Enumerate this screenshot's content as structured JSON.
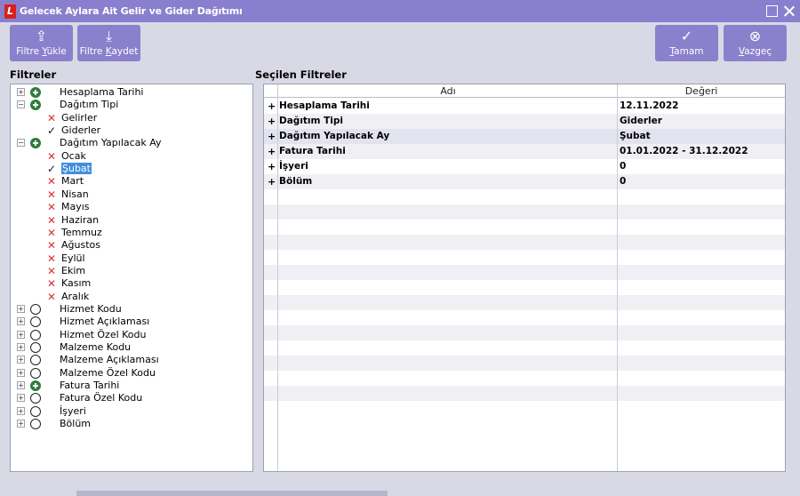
{
  "window": {
    "title": "Gelecek Aylara Ait Gelir ve Gider Dağıtımı",
    "logo_letter": "L"
  },
  "toolbar": {
    "load_filter": {
      "pre": "Filtre ",
      "ul": "Y",
      "post": "ükle",
      "icon": "⇪"
    },
    "save_filter": {
      "pre": "Filtre ",
      "ul": "K",
      "post": "aydet",
      "icon": "⤓"
    },
    "ok": {
      "pre": "",
      "ul": "T",
      "post": "amam",
      "icon": "✓"
    },
    "cancel": {
      "pre": "",
      "ul": "V",
      "post": "azgeç",
      "icon": "⊗"
    }
  },
  "filters_title": "Filtreler",
  "selected_title": "Seçilen Filtreler",
  "tree": [
    {
      "label": "Hesaplama Tarihi",
      "level": 0,
      "expander": "+",
      "status": "on"
    },
    {
      "label": "Dağıtım Tipi",
      "level": 0,
      "expander": "−",
      "status": "on"
    },
    {
      "label": "Gelirler",
      "level": 1,
      "mark": "x"
    },
    {
      "label": "Giderler",
      "level": 1,
      "mark": "ok"
    },
    {
      "label": "Dağıtım Yapılacak  Ay",
      "level": 0,
      "expander": "−",
      "status": "on"
    },
    {
      "label": "Ocak",
      "level": 1,
      "mark": "x"
    },
    {
      "label": "Şubat",
      "level": 1,
      "mark": "ok",
      "selected": true
    },
    {
      "label": "Mart",
      "level": 1,
      "mark": "x"
    },
    {
      "label": "Nisan",
      "level": 1,
      "mark": "x"
    },
    {
      "label": "Mayıs",
      "level": 1,
      "mark": "x"
    },
    {
      "label": "Haziran",
      "level": 1,
      "mark": "x"
    },
    {
      "label": "Temmuz",
      "level": 1,
      "mark": "x"
    },
    {
      "label": "Ağustos",
      "level": 1,
      "mark": "x"
    },
    {
      "label": "Eylül",
      "level": 1,
      "mark": "x"
    },
    {
      "label": "Ekim",
      "level": 1,
      "mark": "x"
    },
    {
      "label": "Kasım",
      "level": 1,
      "mark": "x"
    },
    {
      "label": "Aralık",
      "level": 1,
      "mark": "x"
    },
    {
      "label": "Hizmet Kodu",
      "level": 0,
      "expander": "+",
      "status": "off"
    },
    {
      "label": "Hizmet Açıklaması",
      "level": 0,
      "expander": "+",
      "status": "off"
    },
    {
      "label": "Hizmet Özel Kodu",
      "level": 0,
      "expander": "+",
      "status": "off"
    },
    {
      "label": "Malzeme Kodu",
      "level": 0,
      "expander": "+",
      "status": "off"
    },
    {
      "label": "Malzeme Açıklaması",
      "level": 0,
      "expander": "+",
      "status": "off"
    },
    {
      "label": "Malzeme Özel Kodu",
      "level": 0,
      "expander": "+",
      "status": "off"
    },
    {
      "label": "Fatura Tarihi",
      "level": 0,
      "expander": "+",
      "status": "on"
    },
    {
      "label": "Fatura Özel Kodu",
      "level": 0,
      "expander": "+",
      "status": "off"
    },
    {
      "label": "İşyeri",
      "level": 0,
      "expander": "+",
      "status": "off"
    },
    {
      "label": "Bölüm",
      "level": 0,
      "expander": "+",
      "status": "off"
    }
  ],
  "grid": {
    "col_name": "Adı",
    "col_value": "Değeri",
    "rows": [
      {
        "name": "Hesaplama Tarihi",
        "value": "12.11.2022"
      },
      {
        "name": "Dağıtım Tipi",
        "value": "Giderler"
      },
      {
        "name": "Dağıtım Yapılacak  Ay",
        "value": "Şubat",
        "highlight": true
      },
      {
        "name": "Fatura Tarihi",
        "value": "01.01.2022 - 31.12.2022"
      },
      {
        "name": "İşyeri",
        "value": "0"
      },
      {
        "name": "Bölüm",
        "value": "0"
      }
    ],
    "empty_rows": 14
  }
}
